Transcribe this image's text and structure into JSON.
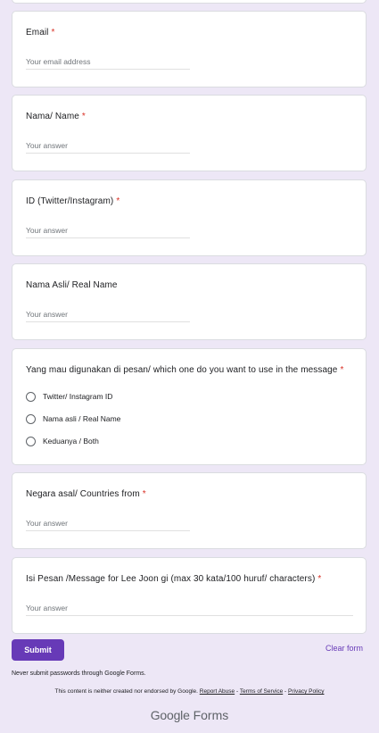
{
  "form": {
    "required_mark": "*",
    "questions": [
      {
        "label": "Email",
        "required": true,
        "placeholder": "Your email address"
      },
      {
        "label": "Nama/ Name",
        "required": true,
        "placeholder": "Your answer"
      },
      {
        "label": "ID (Twitter/Instagram)",
        "required": true,
        "placeholder": "Your answer"
      },
      {
        "label": "Nama Asli/ Real Name",
        "required": false,
        "placeholder": "Your answer"
      },
      {
        "label": "Yang mau digunakan di pesan/ which one do you want to use in the message",
        "required": true,
        "options": [
          "Twitter/ Instagram ID",
          "Nama asli / Real Name",
          "Keduanya / Both"
        ]
      },
      {
        "label": "Negara asal/ Countries from",
        "required": true,
        "placeholder": "Your answer"
      },
      {
        "label": "Isi Pesan /Message for Lee Joon gi (max 30 kata/100 huruf/ characters)",
        "required": true,
        "placeholder": "Your answer"
      }
    ]
  },
  "actions": {
    "submit_label": "Submit",
    "clear_label": "Clear form"
  },
  "footer": {
    "password_note": "Never submit passwords through Google Forms.",
    "disclaimer_text": "This content is neither created nor endorsed by Google.",
    "report_abuse": "Report Abuse",
    "terms": "Terms of Service",
    "privacy": "Privacy Policy",
    "separator": " - ",
    "logo_google": "Google",
    "logo_forms": "Forms"
  },
  "colors": {
    "background": "#ede7f6",
    "accent": "#673ab7",
    "required": "#d93025"
  }
}
